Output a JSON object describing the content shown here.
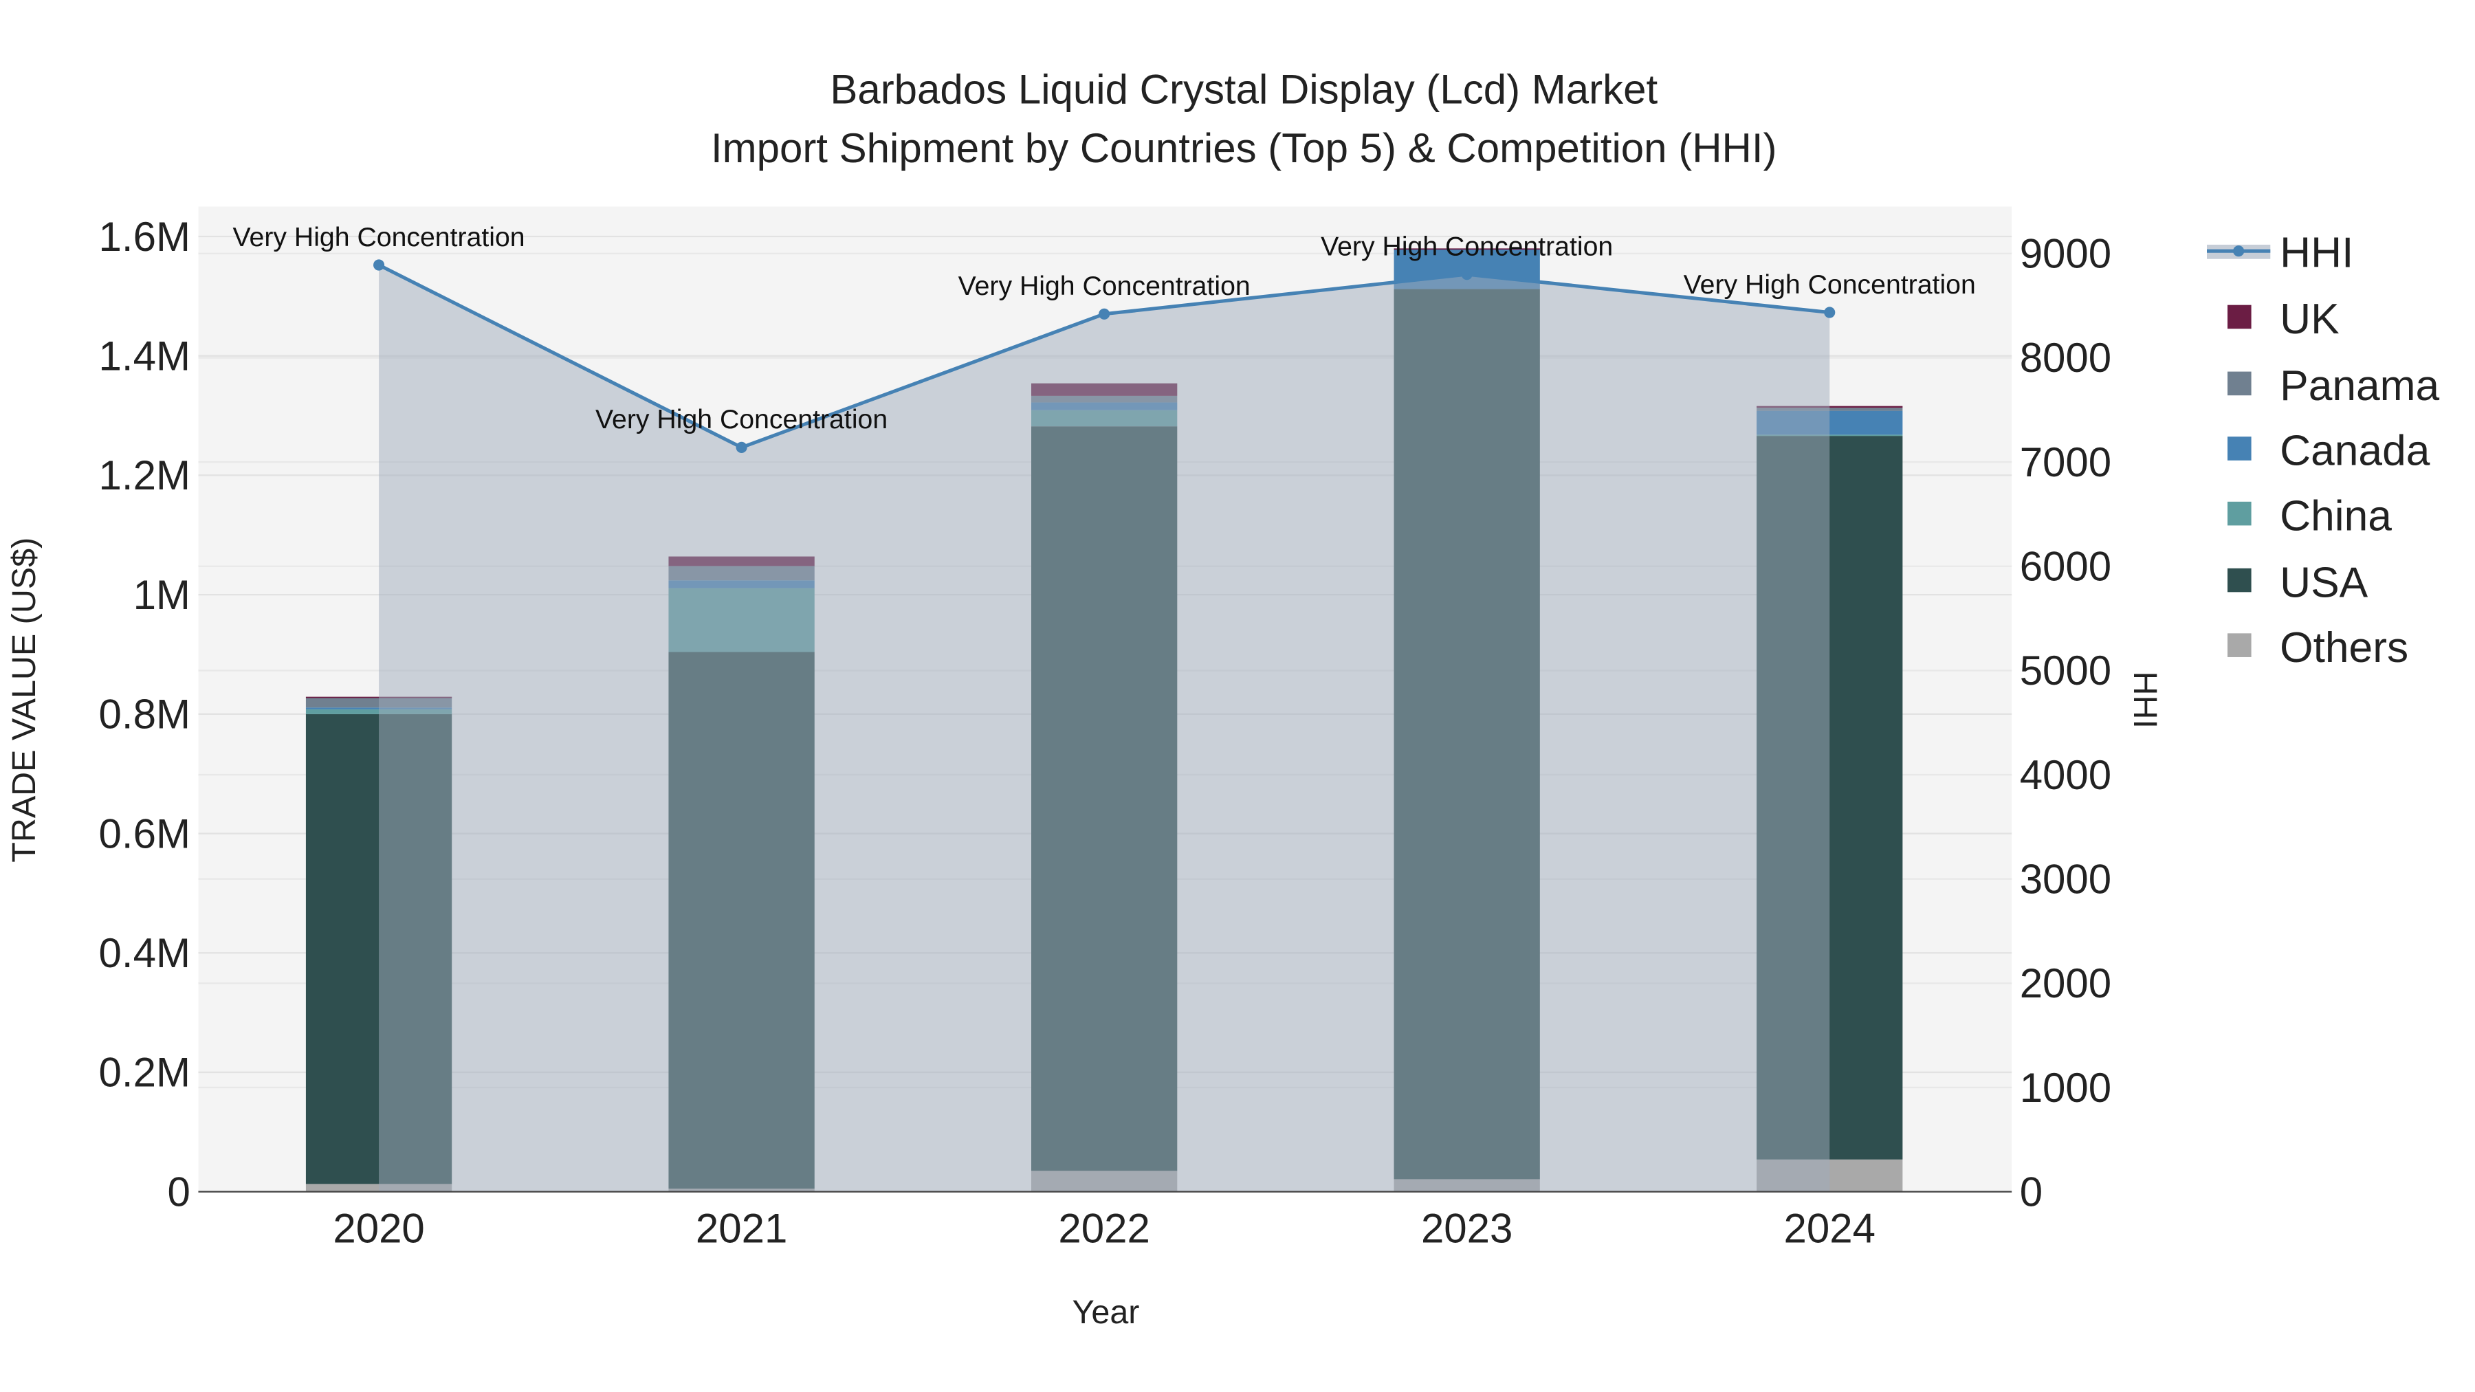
{
  "chart_data": {
    "type": "bar",
    "title_line1": "Barbados Liquid Crystal Display (Lcd) Market",
    "title_line2": "Import Shipment by Countries (Top 5) & Competition (HHI)",
    "xlabel": "Year",
    "ylabel": "TRADE VALUE (US$)",
    "y2label": "HHI",
    "categories": [
      "2020",
      "2021",
      "2022",
      "2023",
      "2024"
    ],
    "ylim": [
      0,
      1650000
    ],
    "y2lim": [
      0,
      9450
    ],
    "yticks": [
      {
        "v": 0,
        "label": "0"
      },
      {
        "v": 200000,
        "label": "0.2M"
      },
      {
        "v": 400000,
        "label": "0.4M"
      },
      {
        "v": 600000,
        "label": "0.6M"
      },
      {
        "v": 800000,
        "label": "0.8M"
      },
      {
        "v": 1000000,
        "label": "1M"
      },
      {
        "v": 1200000,
        "label": "1.2M"
      },
      {
        "v": 1400000,
        "label": "1.4M"
      },
      {
        "v": 1600000,
        "label": "1.6M"
      }
    ],
    "y2ticks": [
      "0",
      "1000",
      "2000",
      "3000",
      "4000",
      "5000",
      "6000",
      "7000",
      "8000",
      "9000"
    ],
    "series": [
      {
        "name": "Others",
        "color": "#a9a9a9",
        "values": [
          13000,
          5000,
          35000,
          21000,
          54000
        ]
      },
      {
        "name": "USA",
        "color": "#2f4f4f",
        "values": [
          787000,
          899000,
          1247000,
          1491000,
          1212000
        ]
      },
      {
        "name": "China",
        "color": "#5f9ea0",
        "values": [
          8000,
          107000,
          27000,
          0,
          2000
        ]
      },
      {
        "name": "Canada",
        "color": "#4682b4",
        "values": [
          3000,
          13000,
          13000,
          67000,
          40000
        ]
      },
      {
        "name": "Panama",
        "color": "#708090",
        "values": [
          17000,
          24000,
          11000,
          0,
          5000
        ]
      },
      {
        "name": "UK",
        "color": "#6b1d44",
        "values": [
          1000,
          16000,
          21000,
          1000,
          3000
        ]
      }
    ],
    "hhi": {
      "name": "HHI",
      "color": "#4682b4",
      "values": [
        8890,
        7140,
        8420,
        8800,
        8435
      ]
    },
    "annotations": [
      "Very High Concentration",
      "Very High Concentration",
      "Very High Concentration",
      "Very High Concentration",
      "Very High Concentration"
    ],
    "legend": [
      "HHI",
      "UK",
      "Panama",
      "Canada",
      "China",
      "USA",
      "Others"
    ],
    "legend_placement": "right"
  }
}
